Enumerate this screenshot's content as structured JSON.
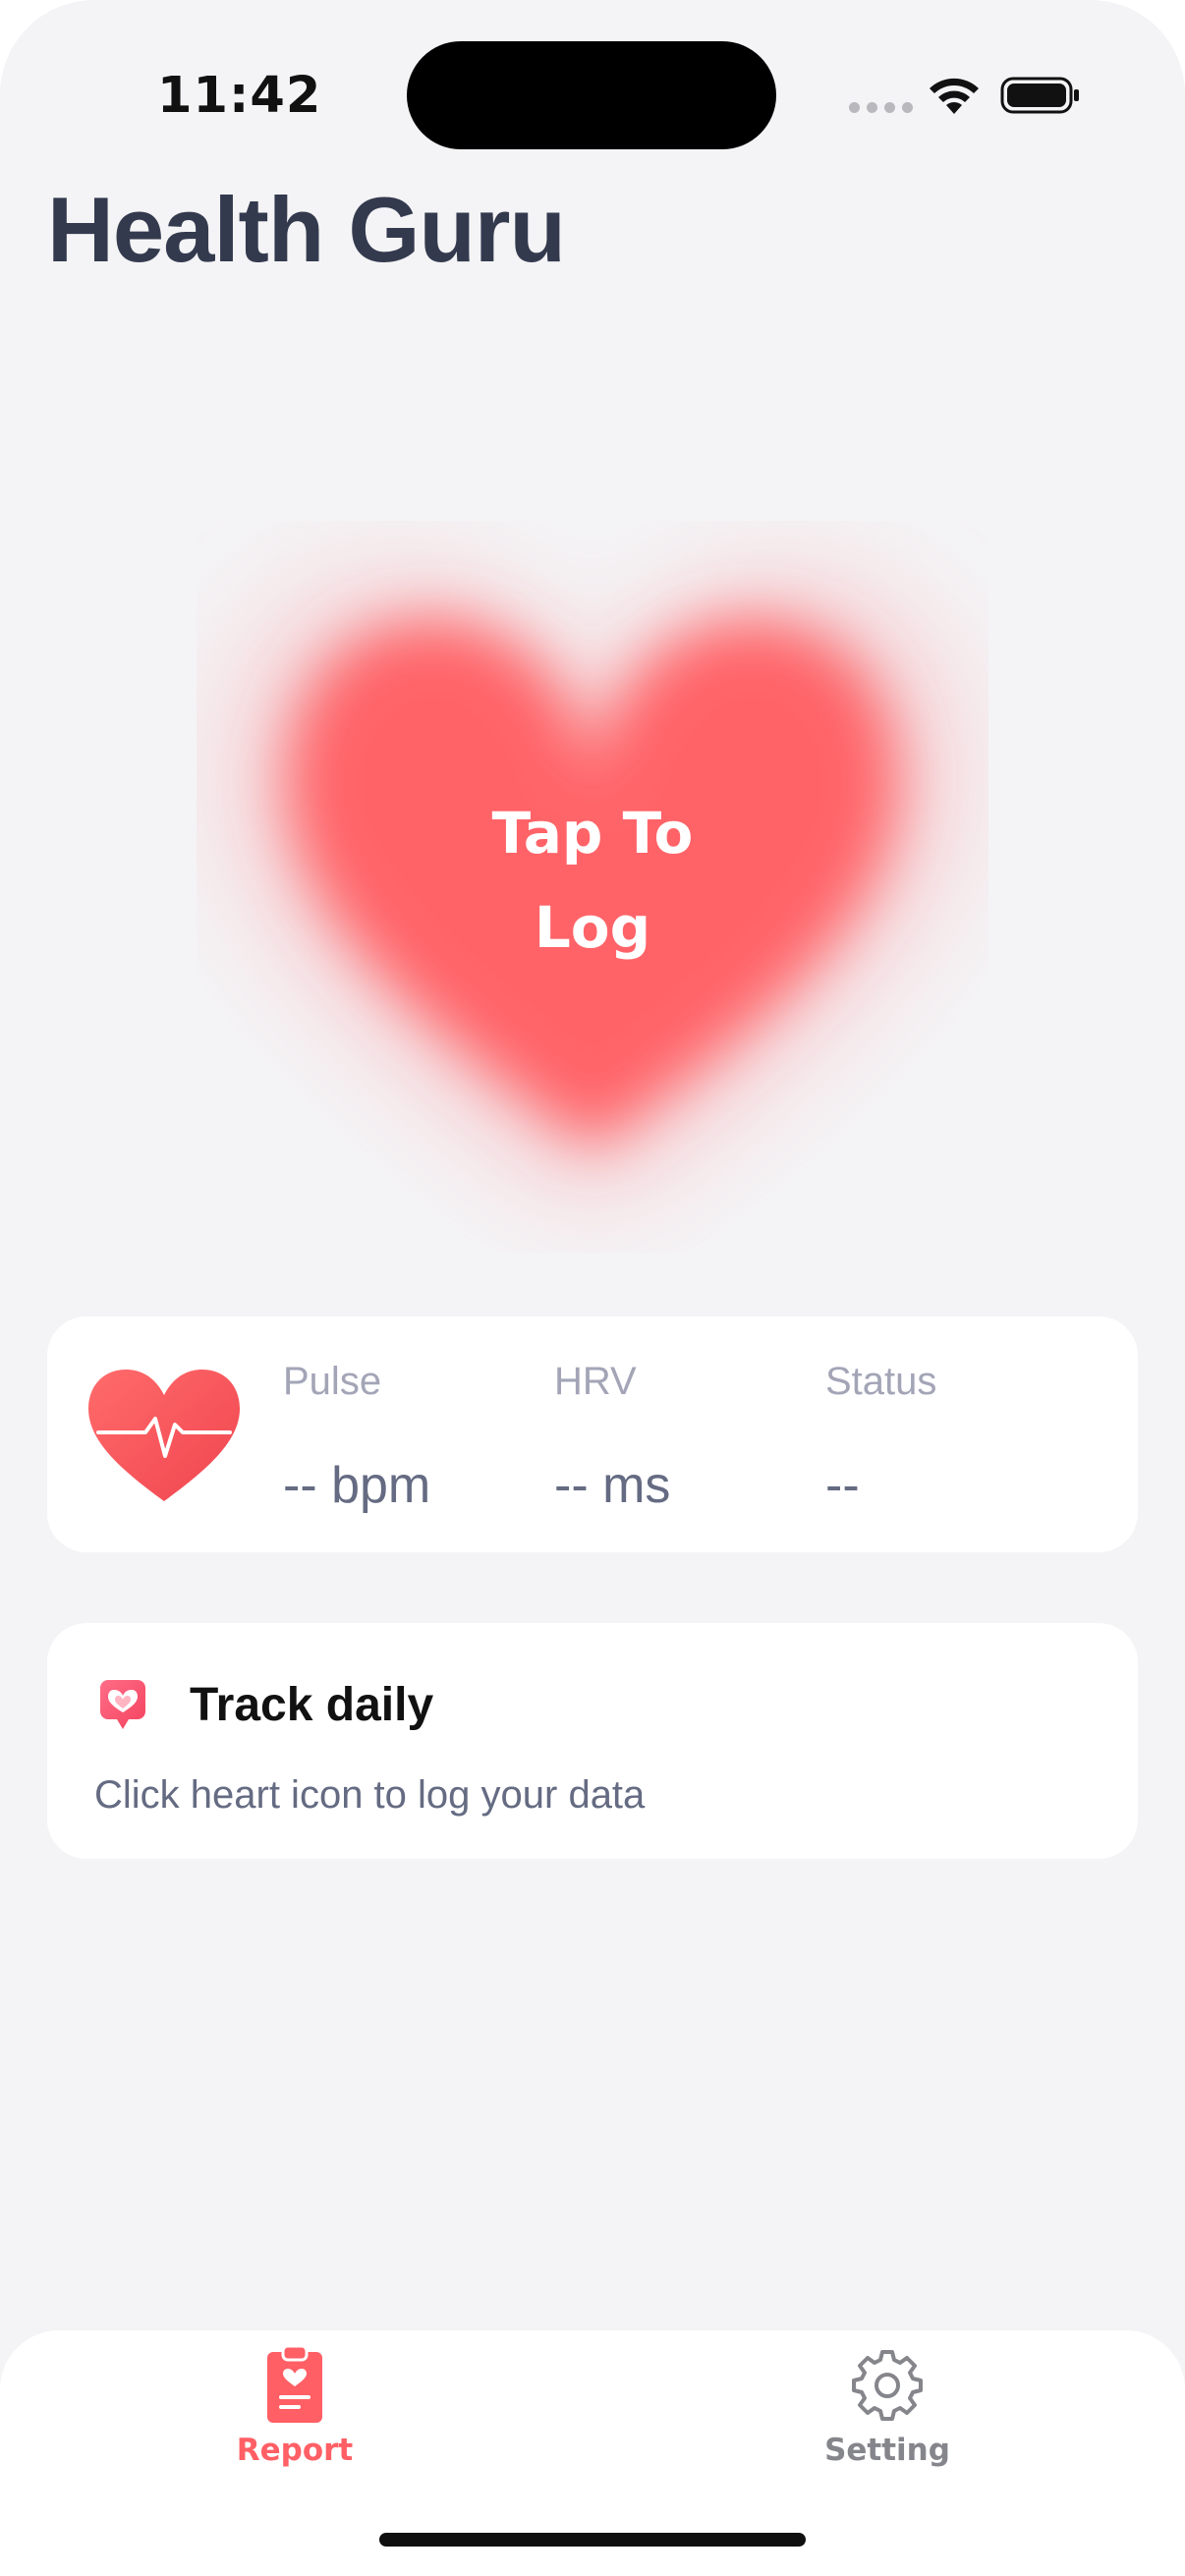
{
  "status_bar": {
    "time": "11:42"
  },
  "header": {
    "title": "Health Guru"
  },
  "heart_button": {
    "line1": "Tap To",
    "line2": "Log",
    "colors": {
      "heart": "#ff6468",
      "halo_inner": "#f5cfd2",
      "halo_outer": "#f7e3e6"
    }
  },
  "stats": {
    "icon": "heart-pulse-icon",
    "pulse": {
      "label": "Pulse",
      "value": "-- bpm"
    },
    "hrv": {
      "label": "HRV",
      "value": "-- ms"
    },
    "status": {
      "label": "Status",
      "value": "--"
    }
  },
  "track": {
    "icon": "heart-bubble-icon",
    "title": "Track daily",
    "subtitle": "Click heart icon to log your data"
  },
  "tab_bar": {
    "tabs": [
      {
        "label": "Report",
        "icon": "clipboard-heart-icon",
        "active": true
      },
      {
        "label": "Setting",
        "icon": "gear-icon",
        "active": false
      }
    ],
    "accent": "#ff5f65",
    "inactive": "#85858c"
  }
}
